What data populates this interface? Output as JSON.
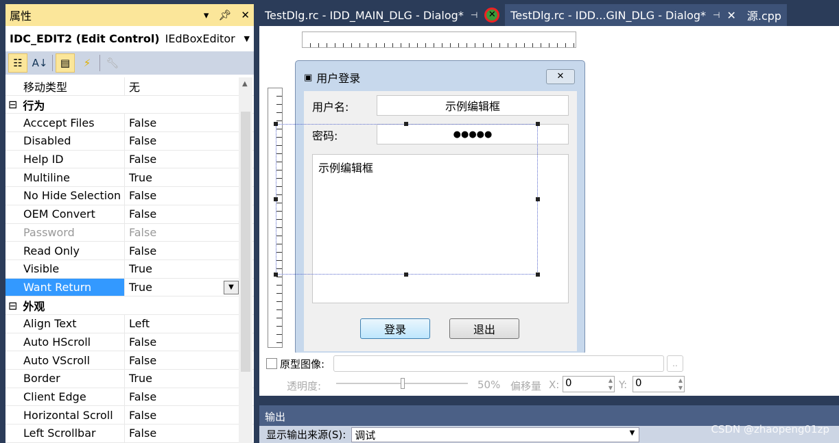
{
  "properties_panel": {
    "title": "属性",
    "object_name": "IDC_EDIT2 (Edit Control)",
    "object_type": "IEdBoxEditor",
    "rows": [
      {
        "name": "移动类型",
        "value": "无"
      },
      {
        "category": "行为"
      },
      {
        "name": "Acccept Files",
        "value": "False"
      },
      {
        "name": "Disabled",
        "value": "False"
      },
      {
        "name": "Help ID",
        "value": "False"
      },
      {
        "name": "Multiline",
        "value": "True"
      },
      {
        "name": "No Hide Selection",
        "value": "False"
      },
      {
        "name": "OEM Convert",
        "value": "False"
      },
      {
        "name": "Password",
        "value": "False",
        "disabled": true
      },
      {
        "name": "Read Only",
        "value": "False"
      },
      {
        "name": "Visible",
        "value": "True"
      },
      {
        "name": "Want Return",
        "value": "True",
        "selected": true
      },
      {
        "category": "外观"
      },
      {
        "name": "Align Text",
        "value": "Left"
      },
      {
        "name": "Auto HScroll",
        "value": "False"
      },
      {
        "name": "Auto VScroll",
        "value": "False"
      },
      {
        "name": "Border",
        "value": "True"
      },
      {
        "name": "Client Edge",
        "value": "False"
      },
      {
        "name": "Horizontal Scroll",
        "value": "False"
      },
      {
        "name": "Left Scrollbar",
        "value": "False"
      }
    ]
  },
  "tabs": [
    {
      "label": "TestDlg.rc - IDD_MAIN_DLG - Dialog*"
    },
    {
      "label": "TestDlg.rc - IDD...GIN_DLG - Dialog*",
      "active": true
    },
    {
      "label": "源.cpp"
    }
  ],
  "dialog": {
    "title": "用户登录",
    "username_label": "用户名:",
    "username_value": "示例编辑框",
    "password_label": "密码:",
    "password_value": "●●●●●",
    "multiline_value": "示例编辑框",
    "login_button": "登录",
    "exit_button": "退出"
  },
  "overlay": {
    "checkbox_label": "原型图像:",
    "browse": "..",
    "opacity_label": "透明度:",
    "opacity_value": "50%",
    "offset_label": "偏移量",
    "x_label": "X:",
    "x_value": "0",
    "y_label": "Y:",
    "y_value": "0"
  },
  "output": {
    "title": "输出",
    "source_label": "显示输出来源(S):",
    "source_value": "调试"
  },
  "watermark": "CSDN @zhaopeng01zp"
}
